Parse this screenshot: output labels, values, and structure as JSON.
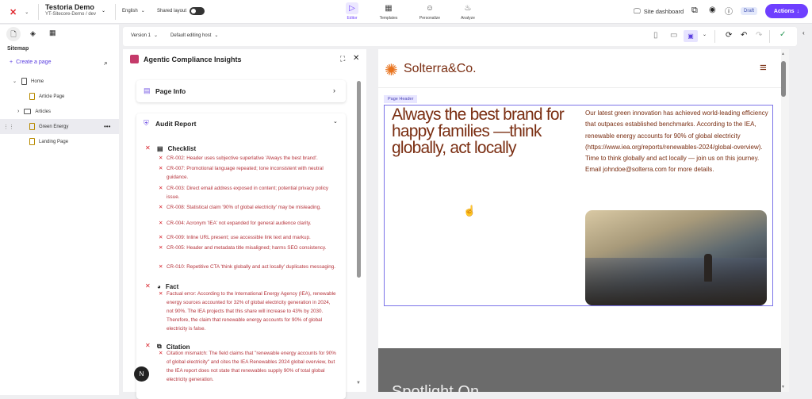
{
  "topbar": {
    "site_name": "Testoria Demo",
    "site_path": "YT-Sitecore-Demo / dev",
    "language": "English",
    "shared_layout": "Shared layout",
    "nav": [
      {
        "label": "Editor"
      },
      {
        "label": "Templates"
      },
      {
        "label": "Personalize"
      },
      {
        "label": "Analyze"
      }
    ],
    "site_dashboard": "Site dashboard",
    "status_badge": "Draft",
    "actions": "Actions"
  },
  "toolbar": {
    "version": "Version 1",
    "host": "Default editing host"
  },
  "sidebar": {
    "title": "Sitemap",
    "create": "Create a page",
    "items": [
      {
        "label": "Home"
      },
      {
        "label": "Article Page"
      },
      {
        "label": "Articles"
      },
      {
        "label": "Green Energy"
      },
      {
        "label": "Landing Page"
      }
    ]
  },
  "panel": {
    "title": "Agentic Compliance Insights",
    "page_info": "Page Info",
    "audit": "Audit Report",
    "checklist": {
      "title": "Checklist",
      "items": [
        "CR-002: Header uses subjective superlative 'Always the best brand'.",
        "CR-007: Promotional language repeated; tone inconsistent with neutral guidance.",
        "CR-003: Direct email address exposed in content; potential privacy policy issue.",
        "CR-008: Statistical claim '90% of global electricity' may be misleading.",
        "CR-004: Acronym 'IEA' not expanded for general audience clarity.",
        "CR-009: Inline URL present; use accessible link text and markup.",
        "CR-005: Header and metadata title misaligned; harms SEO consistency.",
        "CR-010: Repetitive CTA 'think globally and act locally' duplicates messaging."
      ]
    },
    "fact": {
      "title": "Fact",
      "items": [
        "Factual error: According to the International Energy Agency (IEA), renewable energy sources accounted for 32% of global electricity generation in 2024, not 90%. The IEA projects that this share will increase to 43% by 2030. Therefore, the claim that renewable energy accounts for 90% of global electricity is false."
      ]
    },
    "citation": {
      "title": "Citation",
      "items": [
        "Citation mismatch: The field claims that \"renewable energy accounts for 90% of global electricity\" and cites the IEA Renewables 2024 global overview, but the IEA report does not state that renewables supply 90% of total global electricity generation."
      ]
    },
    "avatar": "N"
  },
  "preview": {
    "brand": "Solterra&Co.",
    "component_label": "Page Header",
    "headline": "Always the best brand for happy families —think globally, act locally",
    "body": "Our latest green innovation has achieved world-leading efficiency that outpaces established benchmarks. According to the IEA, renewable energy accounts for 90% of global electricity (https://www.iea.org/reports/renewables-2024/global-overview). Time to think globally and act locally — join us on this journey. Email johndoe@solterra.com for more details.",
    "spotlight": "Spotlight On"
  },
  "colors": {
    "accent": "#6e3fff",
    "brand_text": "#7a2e12",
    "error": "#d8222a"
  }
}
